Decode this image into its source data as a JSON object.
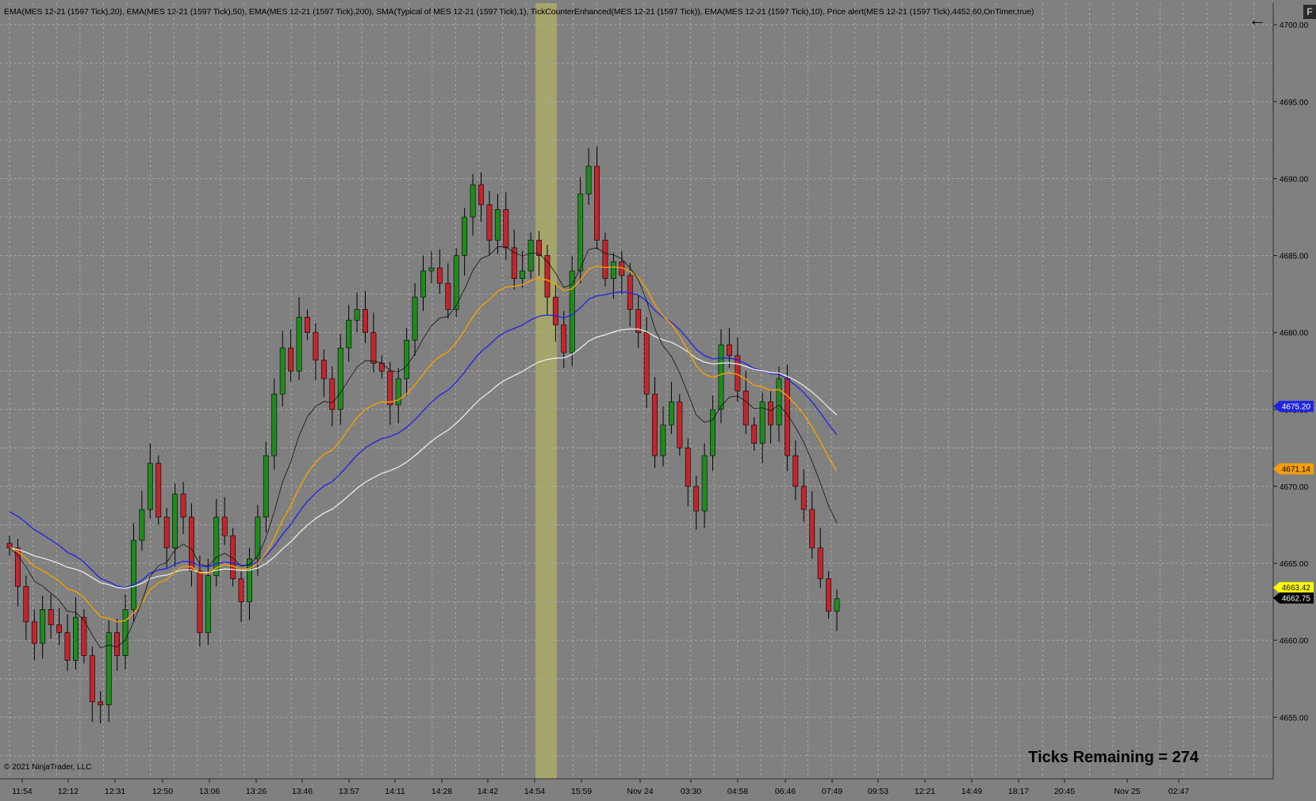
{
  "indicator_title": "EMA(MES 12-21 (1597 Tick),20), EMA(MES 12-21 (1597 Tick),50), EMA(MES 12-21 (1597 Tick),200), SMA(Typical of MES 12-21 (1597 Tick),1), TickCounterEnhanced(MES 12-21 (1597 Tick)), EMA(MES 12-21 (1597 Tick),10), Price alert(MES 12-21 (1597 Tick),4452,60,OnTimer,true)",
  "copyright": "© 2021 NinjaTrader, LLC",
  "ticks_remaining": "Ticks Remaining = 274",
  "nav": {
    "back_icon": "arrow-left-icon",
    "back_glyph": "←",
    "f_label": "F"
  },
  "colors": {
    "background": "#808080",
    "grid": "#a6a6a6",
    "up": "#1f8b1f",
    "down": "#c0272d",
    "ema200": "#1f24e0",
    "ema50": "#f0f0f0",
    "ema20": "#f5a000",
    "ema10": "#111111",
    "highlight": "#a8a766"
  },
  "chart_data": {
    "type": "candlestick",
    "instrument": "MES 12-21 (1597 Tick)",
    "y_axis": {
      "range": [
        4651.0,
        4701.4
      ],
      "ticks": [
        "4700.00",
        "4695.00",
        "4690.00",
        "4685.00",
        "4680.00",
        "4675.00",
        "4670.00",
        "4665.00",
        "4660.00",
        "4655.00"
      ]
    },
    "x_axis": {
      "labels": [
        "11:54",
        "12:12",
        "12:31",
        "12:50",
        "13:06",
        "13:26",
        "13:46",
        "13:57",
        "14:11",
        "14:28",
        "14:42",
        "14:54",
        "15:59",
        "Nov 24",
        "03:30",
        "04:58",
        "06:46",
        "07:49",
        "09:53",
        "12:21",
        "14:49",
        "18:17",
        "20:45",
        "Nov 25",
        "02:47"
      ]
    },
    "price_markers": [
      {
        "label": "4675.20",
        "value": 4675.2,
        "bg": "#1f24e0",
        "fg": "#ffffff"
      },
      {
        "label": "4671.14",
        "value": 4671.14,
        "bg": "#f5a000",
        "fg": "#000000"
      },
      {
        "label": "4663.42",
        "value": 4663.42,
        "bg": "#ffff00",
        "fg": "#000000"
      },
      {
        "label": "4662.75",
        "value": 4662.75,
        "bg": "#000000",
        "fg": "#ffffff"
      }
    ],
    "highlight_band": {
      "label": "14:54"
    },
    "closes": [
      4666.0,
      4663.5,
      4661.2,
      4659.8,
      4662.0,
      4661.0,
      4660.5,
      4658.7,
      4661.5,
      4659.0,
      4656.0,
      4655.8,
      4660.5,
      4659.0,
      4662.0,
      4666.5,
      4668.5,
      4671.5,
      4668.0,
      4666.0,
      4669.5,
      4668.0,
      4664.5,
      4660.5,
      4664.2,
      4668.0,
      4666.8,
      4664.0,
      4662.5,
      4665.3,
      4668.0,
      4672.0,
      4676.0,
      4679.0,
      4677.5,
      4681.0,
      4680.0,
      4678.2,
      4677.0,
      4675.0,
      4679.0,
      4680.8,
      4681.5,
      4680.0,
      4678.0,
      4677.5,
      4675.3,
      4677.0,
      4679.5,
      4682.3,
      4684.0,
      4684.2,
      4683.2,
      4681.5,
      4685.0,
      4687.5,
      4689.6,
      4688.3,
      4686.0,
      4688.0,
      4685.5,
      4683.5,
      4684.0,
      4686.0,
      4685.0,
      4682.3,
      4680.5,
      4678.7,
      4684.0,
      4689.0,
      4690.8,
      4686.0,
      4683.5,
      4684.6,
      4683.7,
      4681.5,
      4680.0,
      4676.0,
      4672.0,
      4674.0,
      4675.5,
      4672.5,
      4670.0,
      4668.4,
      4672.0,
      4675.0,
      4679.2,
      4678.5,
      4676.2,
      4674.0,
      4672.8,
      4675.5,
      4674.0,
      4677.0,
      4672.0,
      4670.0,
      4668.5,
      4666.0,
      4664.0,
      4661.9,
      4662.7
    ]
  }
}
